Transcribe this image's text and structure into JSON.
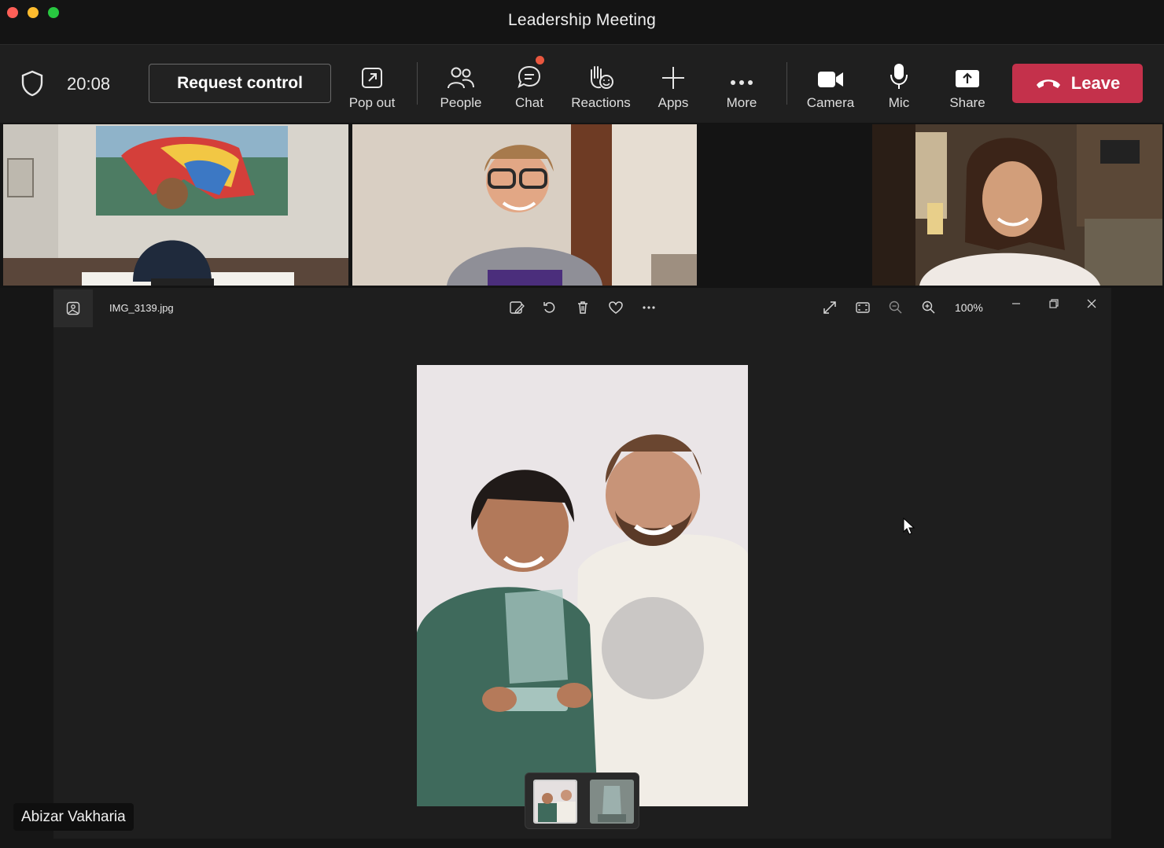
{
  "window": {
    "title": "Leadership Meeting"
  },
  "toolbar": {
    "timer": "20:08",
    "request_control": "Request control",
    "buttons": {
      "popout": "Pop out",
      "people": "People",
      "chat": "Chat",
      "reactions": "Reactions",
      "apps": "Apps",
      "more": "More",
      "camera": "Camera",
      "mic": "Mic",
      "share": "Share"
    },
    "leave": "Leave"
  },
  "viewer": {
    "filename": "IMG_3139.jpg",
    "zoom": "100%"
  },
  "participant": {
    "name": "Abizar Vakharia"
  },
  "colors": {
    "leave_red": "#c4314b",
    "chat_badge": "#e9573f",
    "toolbar_bg": "#1f1f1f"
  }
}
